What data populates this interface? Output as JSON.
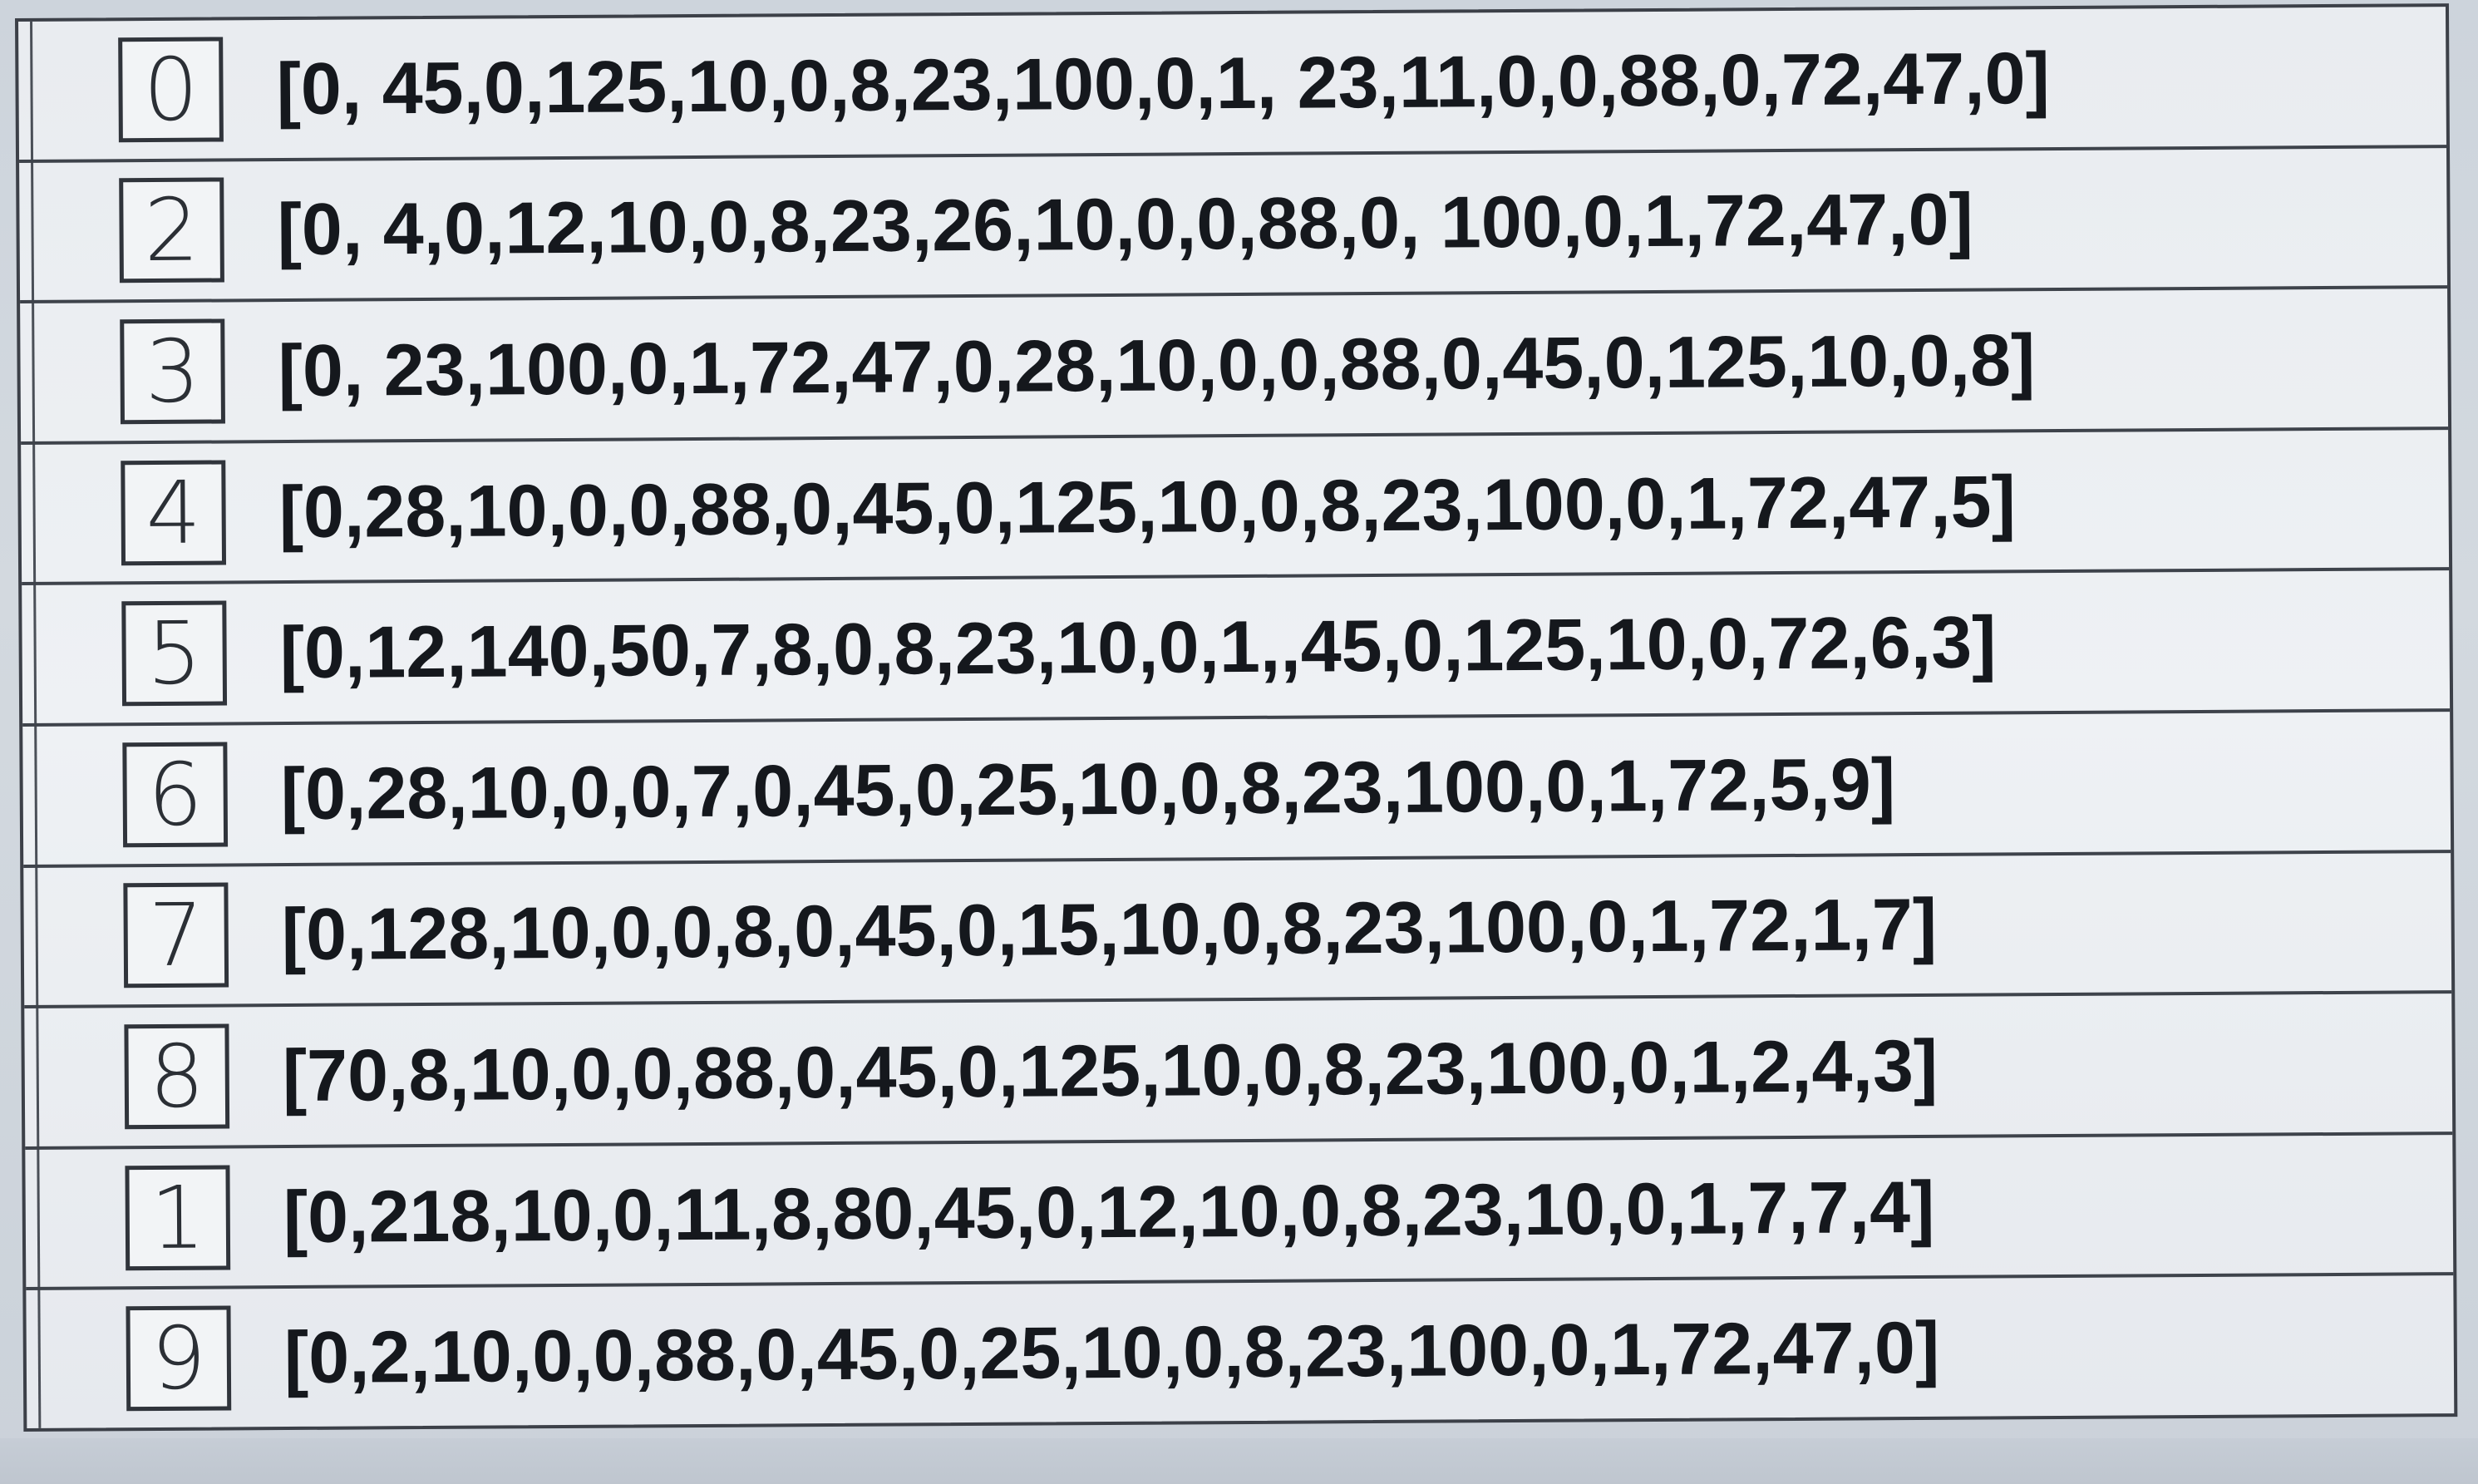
{
  "rows": [
    {
      "digit": "0",
      "vector": "[0, 45,0,125,10,0,8,23,100,0,1, 23,11,0,0,88,0,72,47,0]"
    },
    {
      "digit": "2",
      "vector": "[0, 4,0,12,10,0,8,23,26,10,0,0,88,0, 100,0,1,72,47,0]"
    },
    {
      "digit": "3",
      "vector": "[0, 23,100,0,1,72,47,0,28,10,0,0,88,0,45,0,125,10,0,8]"
    },
    {
      "digit": "4",
      "vector": "[0,28,10,0,0,88,0,45,0,125,10,0,8,23,100,0,1,72,47,5]"
    },
    {
      "digit": "5",
      "vector": "[0,12,140,50,7,8,0,8,23,10,0,1,,45,0,125,10,0,72,6,3]"
    },
    {
      "digit": "6",
      "vector": "[0,28,10,0,0,7,0,45,0,25,10,0,8,23,100,0,1,72,5,9]"
    },
    {
      "digit": "7",
      "vector": "[0,128,10,0,0,8,0,45,0,15,10,0,8,23,100,0,1,72,1,7]"
    },
    {
      "digit": "8",
      "vector": "[70,8,10,0,0,88,0,45,0,125,10,0,8,23,100,0,1,2,4,3]"
    },
    {
      "digit": "1",
      "vector": "[0,218,10,0,11,8,80,45,0,12,10,0,8,23,10,0,1,7,7,4]"
    },
    {
      "digit": "9",
      "vector": "[0,2,10,0,0,88,0,45,0,25,10,0,8,23,100,0,1,72,47,0]"
    }
  ]
}
